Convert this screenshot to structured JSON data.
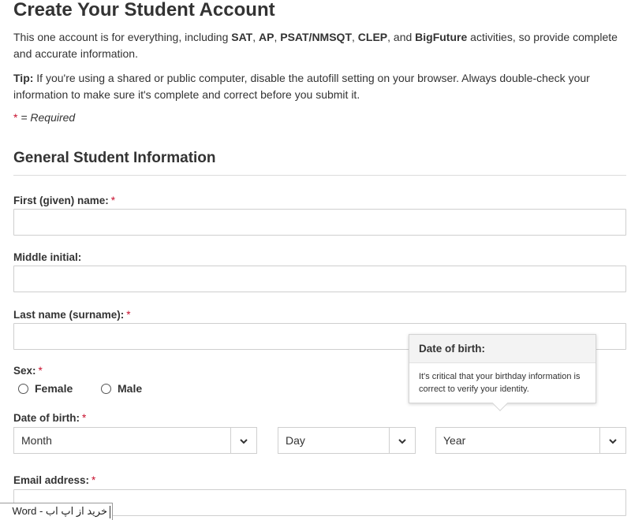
{
  "page": {
    "title": "Create Your Student Account",
    "intro": {
      "prefix": "This one account is for everything, including ",
      "sat": "SAT",
      "sep1": ", ",
      "ap": "AP",
      "sep2": ", ",
      "psat": "PSAT/NMSQT",
      "sep3": ", ",
      "clep": "CLEP",
      "sep4": ", and ",
      "bigfuture": "BigFuture",
      "suffix": " activities, so provide complete and accurate information."
    },
    "tip": {
      "label": "Tip:",
      "text": " If you're using a shared or public computer, disable the autofill setting on your browser. Always double-check your information to make sure it's complete and correct before you submit it."
    },
    "required_note": {
      "star": "*",
      "text": " = Required"
    }
  },
  "section": {
    "title": "General Student Information"
  },
  "fields": {
    "required_marker": "*",
    "first_name": {
      "label": "First (given) name:",
      "value": ""
    },
    "middle_initial": {
      "label": "Middle initial:",
      "value": ""
    },
    "last_name": {
      "label": "Last name (surname):",
      "value": ""
    },
    "sex": {
      "label": "Sex:",
      "options": [
        "Female",
        "Male"
      ]
    },
    "dob": {
      "label": "Date of birth:",
      "month": "Month",
      "day": "Day",
      "year": "Year"
    },
    "email": {
      "label": "Email address:",
      "value": ""
    }
  },
  "tooltip": {
    "title": "Date of birth:",
    "text": "It's critical that your birthday information is correct to verify your identity."
  },
  "taskbar": {
    "label": "خرید از اپ اب - Word"
  },
  "colors": {
    "required": "#c8102e",
    "text": "#333333",
    "border": "#cfcfcf"
  }
}
